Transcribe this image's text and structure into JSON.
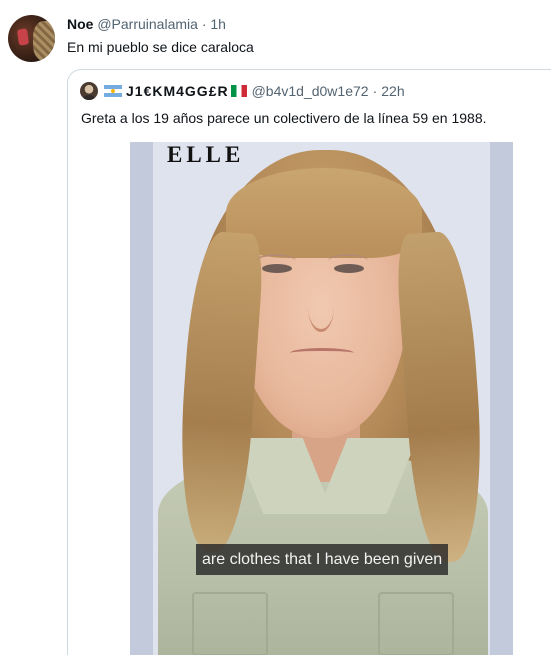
{
  "tweet": {
    "author_name": "Noe",
    "author_handle": "@Parruinalamia",
    "separator": "·",
    "time": "1h",
    "text": "En mi pueblo se dice caraloca"
  },
  "quoted_tweet": {
    "author_name": "J1€KM4GG£R",
    "author_handle": "@b4v1d_d0w1e72",
    "separator": "·",
    "time": "22h",
    "text": "Greta a los 19 años parece un colectivero de la línea 59 en 1988.",
    "media": {
      "watermark": "ELLE",
      "caption": "are clothes that I have been given"
    }
  }
}
